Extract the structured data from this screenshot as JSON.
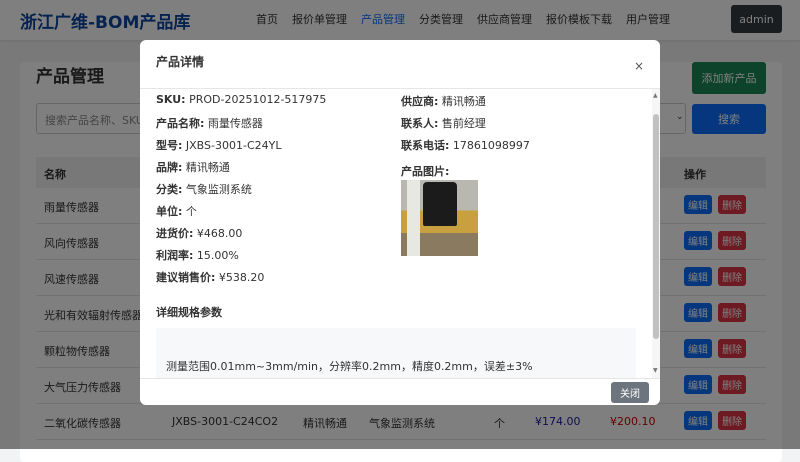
{
  "nav": {
    "brand": "浙江广维-BOM产品库",
    "items": [
      "首页",
      "报价单管理",
      "产品管理",
      "分类管理",
      "供应商管理",
      "报价模板下载",
      "用户管理"
    ],
    "active": 2,
    "user": "admin"
  },
  "page": {
    "title": "产品管理",
    "add_label": "添加新产品",
    "search_placeholder": "搜索产品名称、SKU或",
    "search_label": "搜索",
    "headers": {
      "name": "名称",
      "actions": "操作"
    },
    "rows": [
      "雨量传感器",
      "风向传感器",
      "风速传感器",
      "光和有效辐射传感器",
      "颗粒物传感器",
      "大气压力传感器",
      "二氧化碳传感器"
    ],
    "last_row": {
      "model": "JXBS-3001-C24CO2",
      "brand": "精讯畅通",
      "category": "气象监测系统",
      "unit": "个",
      "cost": "¥174.00",
      "price": "¥200.10"
    },
    "edit_label": "编辑",
    "delete_label": "删除"
  },
  "modal": {
    "title": "产品详情",
    "close_icon": "×",
    "close_label": "关闭",
    "left": [
      {
        "k": "SKU:",
        "v": " PROD-20251012-517975"
      },
      {
        "k": "产品名称:",
        "v": " 雨量传感器"
      },
      {
        "k": "型号:",
        "v": " JXBS-3001-C24YL"
      },
      {
        "k": "品牌:",
        "v": " 精讯畅通"
      },
      {
        "k": "分类:",
        "v": " 气象监测系统"
      },
      {
        "k": "单位:",
        "v": " 个"
      },
      {
        "k": "进货价:",
        "v": " ¥468.00"
      },
      {
        "k": "利润率:",
        "v": " 15.00%"
      },
      {
        "k": "建议销售价:",
        "v": " ¥538.20"
      }
    ],
    "right": [
      {
        "k": "供应商:",
        "v": " 精讯畅通"
      },
      {
        "k": "联系人:",
        "v": " 售前经理"
      },
      {
        "k": "联系电话:",
        "v": " 17861098997"
      }
    ],
    "image_label": "产品图片:",
    "spec_title": "详细规格参数",
    "spec_text": "测量范围0.01mm~3mm/min，分辨率0.2mm，精度0.2mm，误差±3%"
  }
}
